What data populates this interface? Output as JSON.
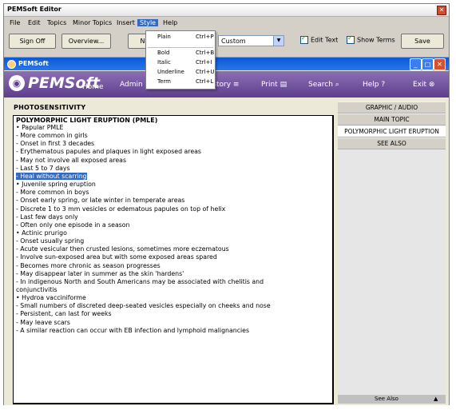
{
  "window_title": "PEMSoft Editor",
  "menu": [
    "File",
    "Edit",
    "Topics",
    "Minor Topics",
    "Insert",
    "Style",
    "Help"
  ],
  "toolbar": {
    "sign_off": "Sign Off",
    "overview": "Overview...",
    "no_label": "No",
    "style_value": "Custom",
    "edit_text": "Edit Text",
    "show_terms": "Show Terms",
    "save": "Save"
  },
  "style_menu": [
    {
      "label": "Plain",
      "shortcut": "Ctrl+P"
    },
    {
      "label": "Bold",
      "shortcut": "Ctrl+B"
    },
    {
      "label": "Italic",
      "shortcut": "Ctrl+I"
    },
    {
      "label": "Underline",
      "shortcut": "Ctrl+U"
    },
    {
      "label": "Term",
      "shortcut": "Ctrl+L"
    }
  ],
  "inner_title": "PEMSoft",
  "nav": {
    "logo": "PEMSoft",
    "home": "Home",
    "admin": "Admin",
    "to": "To",
    "history": "History",
    "print": "Print",
    "search": "Search",
    "help": "Help",
    "exit": "Exit"
  },
  "section_title": "PHOTOSENSITIVITY",
  "content_title": "POLYMORPHIC LIGHT ERUPTION (PMLE)",
  "lines": [
    "• Papular PMLE",
    "- More common in girls",
    "- Onset in first 3 decades",
    "- Erythematous papules and plaques in light exposed areas",
    "- May not involve all exposed areas",
    "- Last 5 to 7 days",
    "- Heal without scarring",
    "• Juvenile spring eruption",
    "- More common in boys",
    "- Onset early spring, or late winter in temperate areas",
    "- Discrete 1 to 3 mm vesicles or edematous papules on top of helix",
    "- Last few days only",
    "- Often only one episode in a season",
    "• Actinic prurigo",
    "- Onset usually spring",
    "- Acute vesicular then crusted lesions, sometimes more eczematous",
    "- Involve sun-exposed area but with some exposed areas spared",
    "- Becomes more chronic as season progresses",
    "- May disappear later in summer as the skin 'hardens'",
    "- In indigenous North and South Americans may be associated with chelitis and",
    "conjunctivitis",
    "• Hydroa vacciniforme",
    "- Small numbers of discreted deep-seated vesicles especially on cheeks and nose",
    "- Persistent, can last for weeks",
    "- May leave scars",
    "- A similar reaction can occur with EB infection and lymphoid malignancies"
  ],
  "side": [
    "GRAPHIC / AUDIO",
    "MAIN TOPIC",
    "POLYMORPHIC LIGHT ERUPTION",
    "SEE ALSO"
  ],
  "side_bottom": "See Also",
  "side_bottom_arrow": "▲"
}
